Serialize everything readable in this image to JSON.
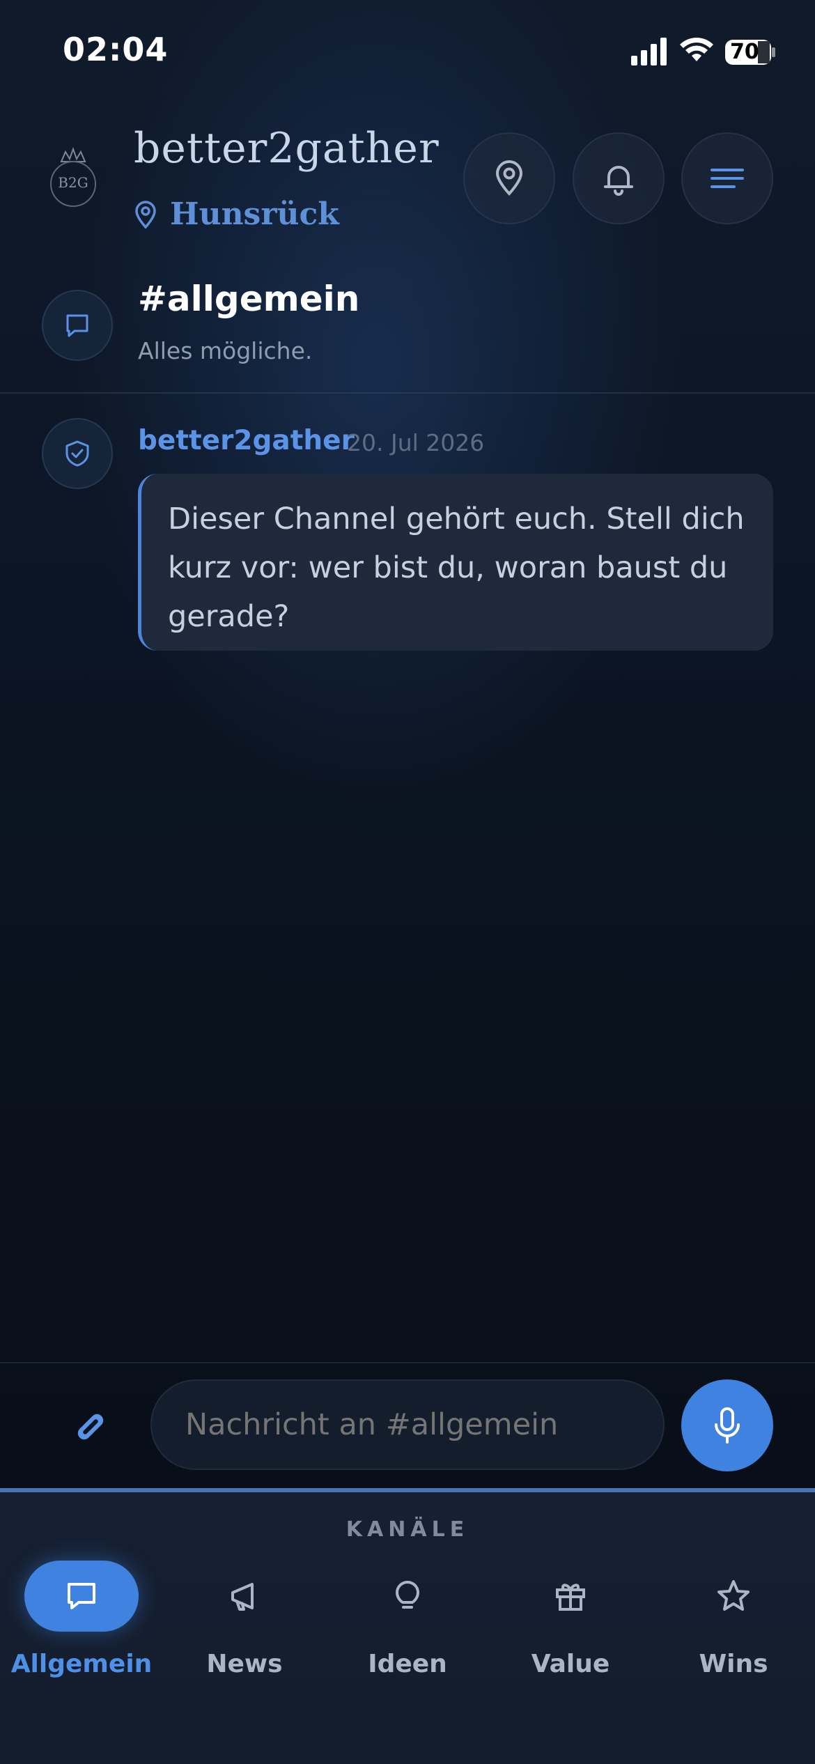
{
  "status_bar": {
    "time": "02:04",
    "battery": "70"
  },
  "header": {
    "logo_text": "B2G",
    "brand": "better2gather",
    "location": "Hunsrück",
    "buttons": {
      "map": "map-pin-icon",
      "notifications": "bell-icon",
      "menu": "menu-icon"
    }
  },
  "channel": {
    "title": "#allgemein",
    "description": "Alles mögliche."
  },
  "messages": [
    {
      "author": "better2gather",
      "timestamp": "20. Jul 2026",
      "text": "Dieser Channel gehört euch. Stell dich kurz vor: wer bist du, woran baust du gerade?"
    }
  ],
  "composer": {
    "placeholder": "Nachricht an #allgemein"
  },
  "tabbar": {
    "heading": "KANÄLE",
    "tabs": [
      {
        "label": "Allgemein",
        "icon": "chat-icon",
        "active": true
      },
      {
        "label": "News",
        "icon": "megaphone-icon",
        "active": false
      },
      {
        "label": "Ideen",
        "icon": "lightbulb-icon",
        "active": false
      },
      {
        "label": "Value",
        "icon": "gift-icon",
        "active": false
      },
      {
        "label": "Wins",
        "icon": "star-icon",
        "active": false
      }
    ]
  },
  "colors": {
    "accent": "#3f82e0",
    "author": "#5b94e6",
    "location": "#5f8fd6"
  }
}
